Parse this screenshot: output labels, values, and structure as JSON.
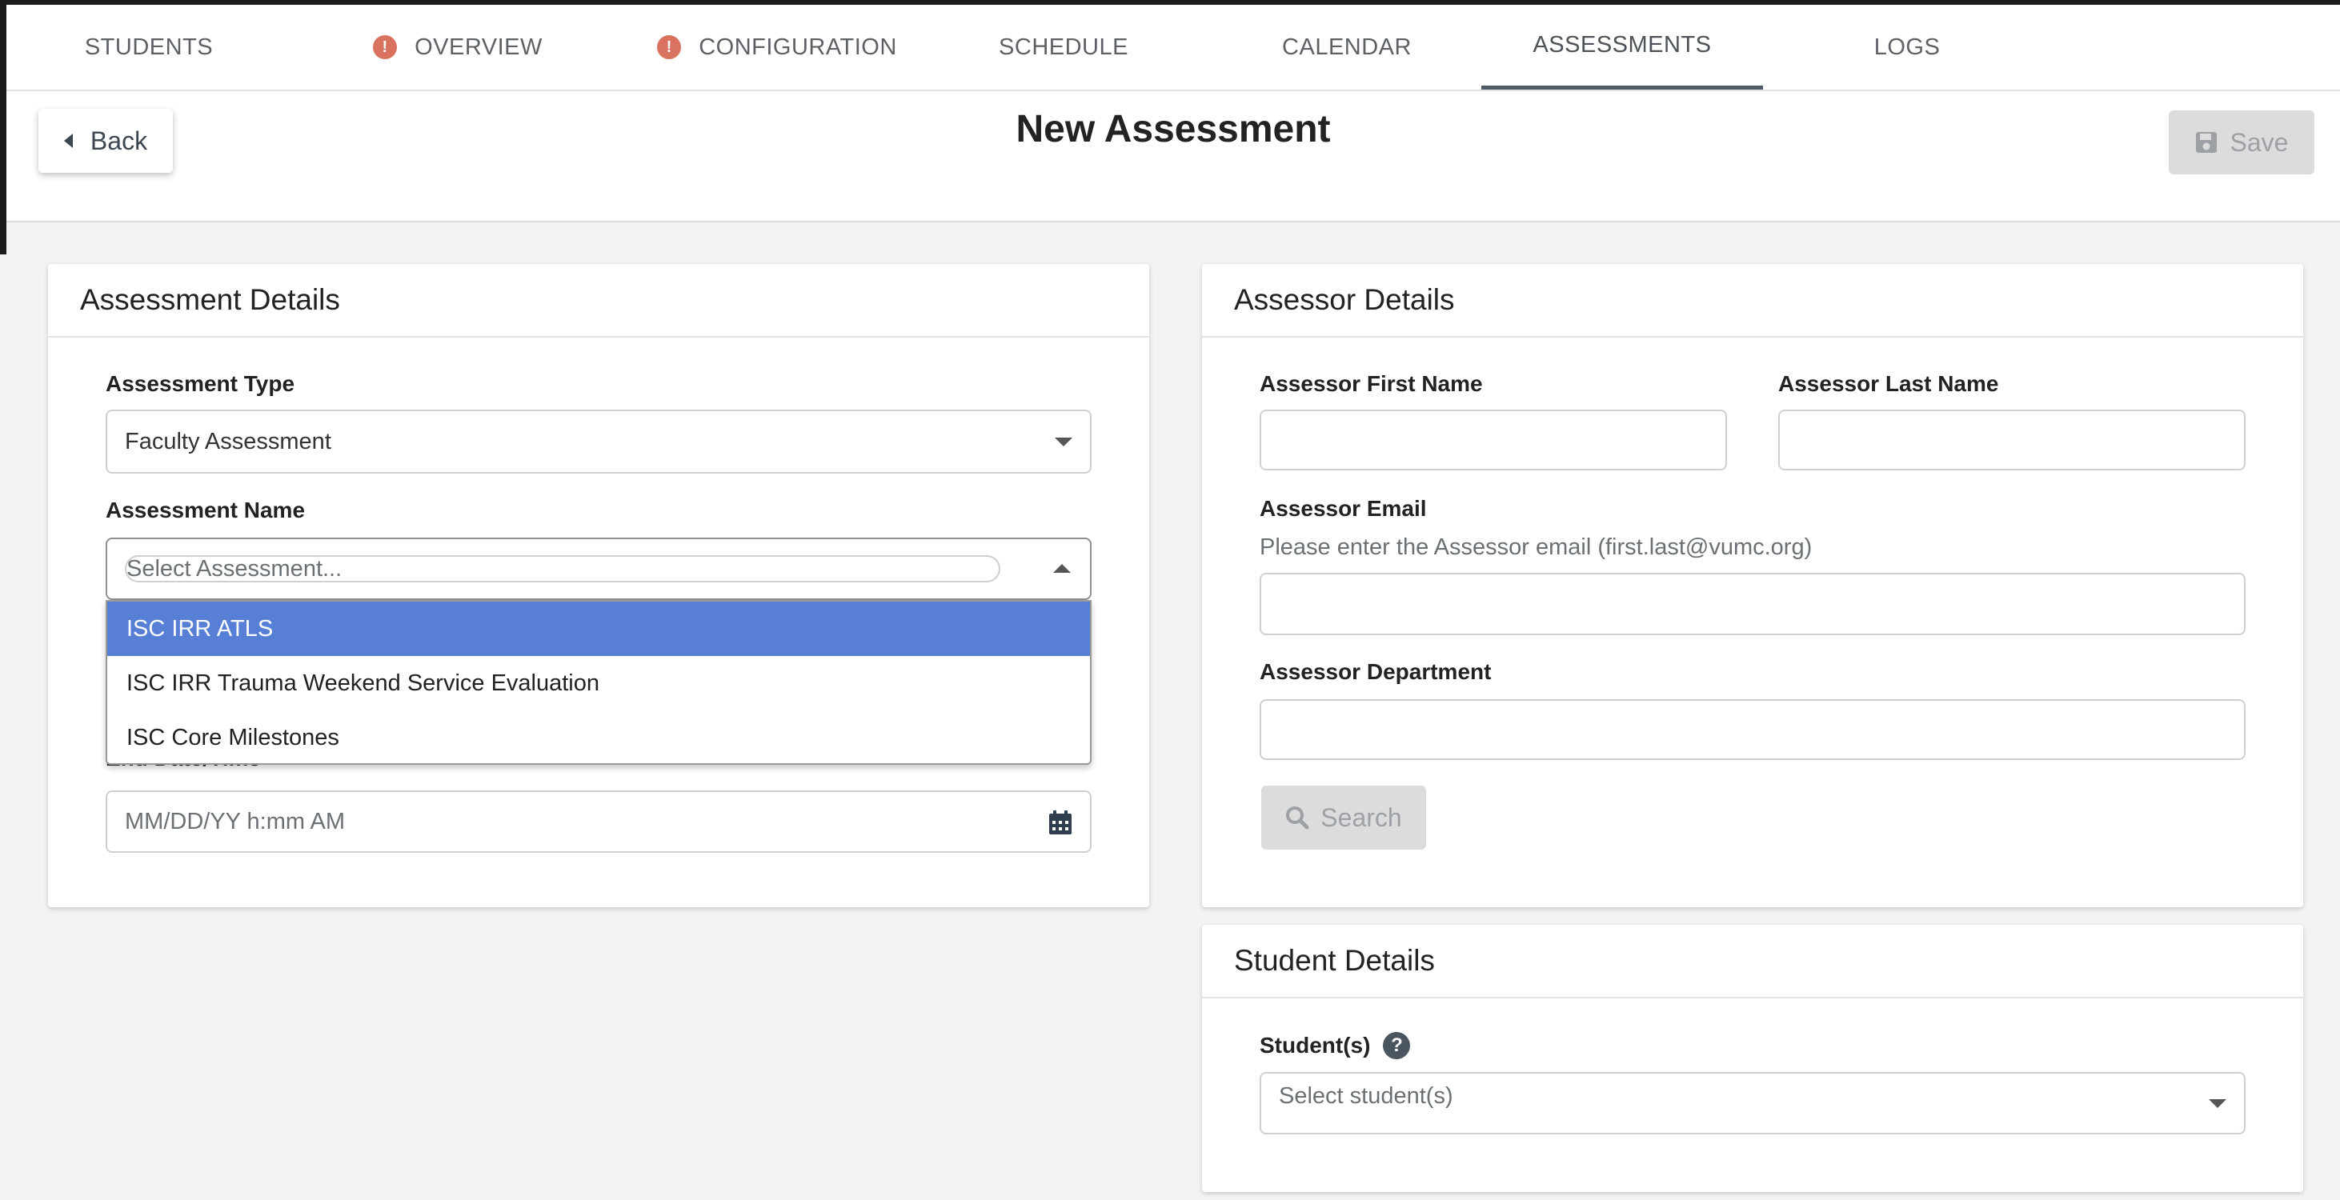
{
  "tabs": [
    {
      "label": "STUDENTS",
      "warning": false
    },
    {
      "label": "OVERVIEW",
      "warning": true
    },
    {
      "label": "CONFIGURATION",
      "warning": true
    },
    {
      "label": "SCHEDULE",
      "warning": false
    },
    {
      "label": "CALENDAR",
      "warning": false
    },
    {
      "label": "ASSESSMENTS",
      "warning": false,
      "active": true
    },
    {
      "label": "LOGS",
      "warning": false
    }
  ],
  "header": {
    "back_label": "Back",
    "title": "New Assessment",
    "save_label": "Save"
  },
  "assessment_details": {
    "title": "Assessment Details",
    "type_label": "Assessment Type",
    "type_value": "Faculty Assessment",
    "name_label": "Assessment Name",
    "name_placeholder": "Select Assessment...",
    "name_options": [
      "ISC IRR ATLS",
      "ISC IRR Trauma Weekend Service Evaluation",
      "ISC Core Milestones"
    ],
    "end_label": "End Date/Time",
    "end_placeholder": "MM/DD/YY h:mm AM"
  },
  "assessor_details": {
    "title": "Assessor Details",
    "first_name_label": "Assessor First Name",
    "last_name_label": "Assessor Last Name",
    "email_label": "Assessor Email",
    "email_hint": "Please enter the Assessor email (first.last@vumc.org)",
    "department_label": "Assessor Department",
    "search_label": "Search"
  },
  "student_details": {
    "title": "Student Details",
    "students_label": "Student(s)",
    "students_placeholder": "Select student(s)"
  },
  "colors": {
    "accent_highlight": "#567fd5",
    "warning": "#d9735f",
    "disabled_bg": "#dcdcdc"
  }
}
